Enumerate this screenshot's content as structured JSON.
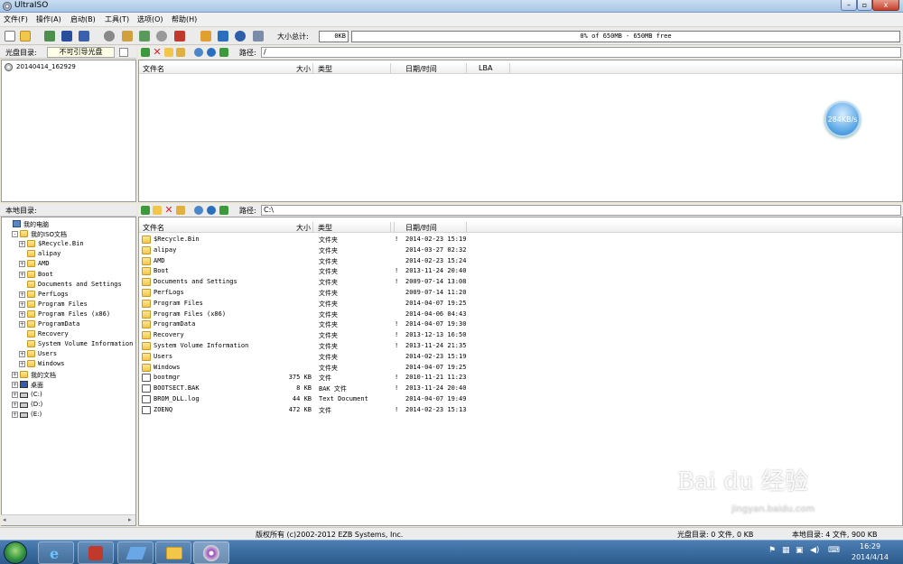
{
  "window": {
    "title": "UltraISO",
    "minimize": "–",
    "maximize": "▫",
    "close": "x"
  },
  "menu": [
    "文件(F)",
    "操作(A)",
    "启动(B)",
    "工具(T)",
    "选项(O)",
    "帮助(H)"
  ],
  "toolbar": {
    "size_label": "大小总计:",
    "size_value": "0KB",
    "capacity_text": "0% of 650MB - 650MB free"
  },
  "disc": {
    "header_label": "光盘目录:",
    "boot_label": "不可引导光盘",
    "root": "20140414_162929",
    "path_label": "路径:",
    "path_value": "/",
    "columns": {
      "name": "文件名",
      "size": "大小",
      "type": "类型",
      "date": "日期/时间",
      "lba": "LBA"
    }
  },
  "speed": "284KB/s",
  "local": {
    "header_label": "本地目录:",
    "path_label": "路径:",
    "path_value": "C:\\",
    "tree": [
      {
        "label": "我的电脑",
        "level": 0,
        "exp": "",
        "icon": "computer"
      },
      {
        "label": "我的ISO文档",
        "level": 1,
        "exp": "-",
        "icon": "folder"
      },
      {
        "label": "$Recycle.Bin",
        "level": 2,
        "exp": "+",
        "icon": "folder"
      },
      {
        "label": "alipay",
        "level": 2,
        "exp": "",
        "icon": "folder"
      },
      {
        "label": "AMD",
        "level": 2,
        "exp": "+",
        "icon": "folder"
      },
      {
        "label": "Boot",
        "level": 2,
        "exp": "+",
        "icon": "folder"
      },
      {
        "label": "Documents and Settings",
        "level": 2,
        "exp": "",
        "icon": "folder"
      },
      {
        "label": "PerfLogs",
        "level": 2,
        "exp": "+",
        "icon": "folder"
      },
      {
        "label": "Program Files",
        "level": 2,
        "exp": "+",
        "icon": "folder"
      },
      {
        "label": "Program Files (x86)",
        "level": 2,
        "exp": "+",
        "icon": "folder"
      },
      {
        "label": "ProgramData",
        "level": 2,
        "exp": "+",
        "icon": "folder"
      },
      {
        "label": "Recovery",
        "level": 2,
        "exp": "",
        "icon": "folder"
      },
      {
        "label": "System Volume Information",
        "level": 2,
        "exp": "",
        "icon": "folder"
      },
      {
        "label": "Users",
        "level": 2,
        "exp": "+",
        "icon": "folder"
      },
      {
        "label": "Windows",
        "level": 2,
        "exp": "+",
        "icon": "folder"
      },
      {
        "label": "我的文档",
        "level": 1,
        "exp": "+",
        "icon": "folder"
      },
      {
        "label": "桌面",
        "level": 1,
        "exp": "+",
        "icon": "desktop"
      },
      {
        "label": "(C:)",
        "level": 1,
        "exp": "+",
        "icon": "drive"
      },
      {
        "label": "(D:)",
        "level": 1,
        "exp": "+",
        "icon": "drive"
      },
      {
        "label": "(E:)",
        "level": 1,
        "exp": "+",
        "icon": "drive"
      }
    ],
    "columns": {
      "name": "文件名",
      "size": "大小",
      "type": "类型",
      "date": "日期/时间"
    },
    "files": [
      {
        "name": "$Recycle.Bin",
        "size": "",
        "type": "文件夹",
        "flag": "!",
        "date": "2014-02-23 15:19",
        "icon": "folder"
      },
      {
        "name": "alipay",
        "size": "",
        "type": "文件夹",
        "flag": "",
        "date": "2014-03-27 02:32",
        "icon": "folder"
      },
      {
        "name": "AMD",
        "size": "",
        "type": "文件夹",
        "flag": "",
        "date": "2014-02-23 15:24",
        "icon": "folder"
      },
      {
        "name": "Boot",
        "size": "",
        "type": "文件夹",
        "flag": "!",
        "date": "2013-11-24 20:40",
        "icon": "folder"
      },
      {
        "name": "Documents and Settings",
        "size": "",
        "type": "文件夹",
        "flag": "!",
        "date": "2009-07-14 13:08",
        "icon": "folder"
      },
      {
        "name": "PerfLogs",
        "size": "",
        "type": "文件夹",
        "flag": "",
        "date": "2009-07-14 11:20",
        "icon": "folder"
      },
      {
        "name": "Program Files",
        "size": "",
        "type": "文件夹",
        "flag": "",
        "date": "2014-04-07 19:25",
        "icon": "folder"
      },
      {
        "name": "Program Files (x86)",
        "size": "",
        "type": "文件夹",
        "flag": "",
        "date": "2014-04-06 04:43",
        "icon": "folder"
      },
      {
        "name": "ProgramData",
        "size": "",
        "type": "文件夹",
        "flag": "!",
        "date": "2014-04-07 19:30",
        "icon": "folder"
      },
      {
        "name": "Recovery",
        "size": "",
        "type": "文件夹",
        "flag": "!",
        "date": "2013-12-13 16:50",
        "icon": "folder"
      },
      {
        "name": "System Volume Information",
        "size": "",
        "type": "文件夹",
        "flag": "!",
        "date": "2013-11-24 21:35",
        "icon": "folder"
      },
      {
        "name": "Users",
        "size": "",
        "type": "文件夹",
        "flag": "",
        "date": "2014-02-23 15:19",
        "icon": "folder"
      },
      {
        "name": "Windows",
        "size": "",
        "type": "文件夹",
        "flag": "",
        "date": "2014-04-07 19:25",
        "icon": "folder"
      },
      {
        "name": "bootmgr",
        "size": "375 KB",
        "type": "文件",
        "flag": "!",
        "date": "2010-11-21 11:23",
        "icon": "doc"
      },
      {
        "name": "BOOTSECT.BAK",
        "size": "8 KB",
        "type": "BAK 文件",
        "flag": "!",
        "date": "2013-11-24 20:40",
        "icon": "doc"
      },
      {
        "name": "BROM_DLL.log",
        "size": "44 KB",
        "type": "Text Document",
        "flag": "",
        "date": "2014-04-07 19:49",
        "icon": "doc"
      },
      {
        "name": "ZOENQ",
        "size": "472 KB",
        "type": "文件",
        "flag": "!",
        "date": "2014-02-23 15:13",
        "icon": "doc"
      }
    ]
  },
  "status": {
    "copyright": "版权所有 (c)2002-2012 EZB Systems, Inc.",
    "disc_status": "光盘目录: 0 文件, 0 KB",
    "local_status": "本地目录: 4 文件, 900 KB"
  },
  "taskbar": {
    "time": "16:29",
    "date": "2014/4/14"
  },
  "watermark": {
    "logo": "Bai du 经验",
    "url": "jingyan.baidu.com"
  }
}
